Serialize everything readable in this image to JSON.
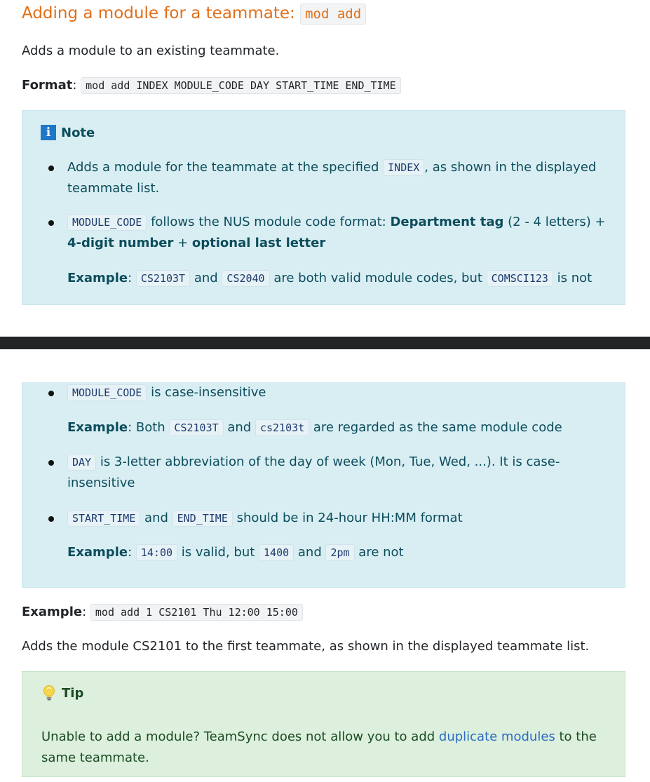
{
  "heading": {
    "text": "Adding a module for a teammate: ",
    "code": "mod add"
  },
  "description": "Adds a module to an existing teammate.",
  "format": {
    "label": "Format",
    "colon": ":",
    "code": "mod add INDEX MODULE_CODE DAY START_TIME END_TIME"
  },
  "note": {
    "icon": "info-icon",
    "label": "Note",
    "item1": {
      "text_a": "Adds a module for the teammate at the specified ",
      "code": "INDEX",
      "text_b": ", as shown in the displayed",
      "text_c": "teammate list."
    },
    "item2": {
      "code": "MODULE_CODE",
      "text_a": " follows the NUS module code format: ",
      "bold_a": "Department tag",
      "text_b": " (2 - 4 letters) +",
      "bold_b": "4-digit number",
      "text_c": " + ",
      "bold_c": "optional last letter",
      "example_label": "Example",
      "example_colon": ": ",
      "ex_code1": "CS2103T",
      "ex_and": " and ",
      "ex_code2": "CS2040",
      "ex_text": " are both valid module codes, but ",
      "ex_code3": "COMSCI123",
      "ex_tail": " is not"
    },
    "item3": {
      "code": "MODULE_CODE",
      "text": " is case-insensitive",
      "example_label": "Example",
      "example_text": ": Both ",
      "ex_code1": "CS2103T",
      "ex_and": " and ",
      "ex_code2": "cs2103t",
      "ex_tail": " are regarded as the same module code"
    },
    "item4": {
      "code": "DAY",
      "text_a": " is 3-letter abbreviation of the day of week (Mon, Tue, Wed, ...). It is case-",
      "text_b": "insensitive"
    },
    "item5": {
      "code1": "START_TIME",
      "and": " and ",
      "code2": "END_TIME",
      "text": " should be in 24-hour HH:MM format",
      "example_label": "Example",
      "example_colon": ": ",
      "ex_code1": "14:00",
      "ex_text": " is valid, but ",
      "ex_code2": "1400",
      "ex_and": " and ",
      "ex_code3": "2pm",
      "ex_tail": " are not"
    }
  },
  "example": {
    "label": "Example",
    "colon": ":",
    "code": "mod add 1 CS2101 Thu 12:00 15:00",
    "explanation": "Adds the module CS2101 to the first teammate, as shown in the displayed teammate list."
  },
  "tip": {
    "icon": "lightbulb-icon",
    "label": "Tip",
    "text_a": "Unable to add a module? TeamSync does not allow you to add ",
    "link": "duplicate modules",
    "text_b": " to the",
    "text_c": "same teammate."
  }
}
